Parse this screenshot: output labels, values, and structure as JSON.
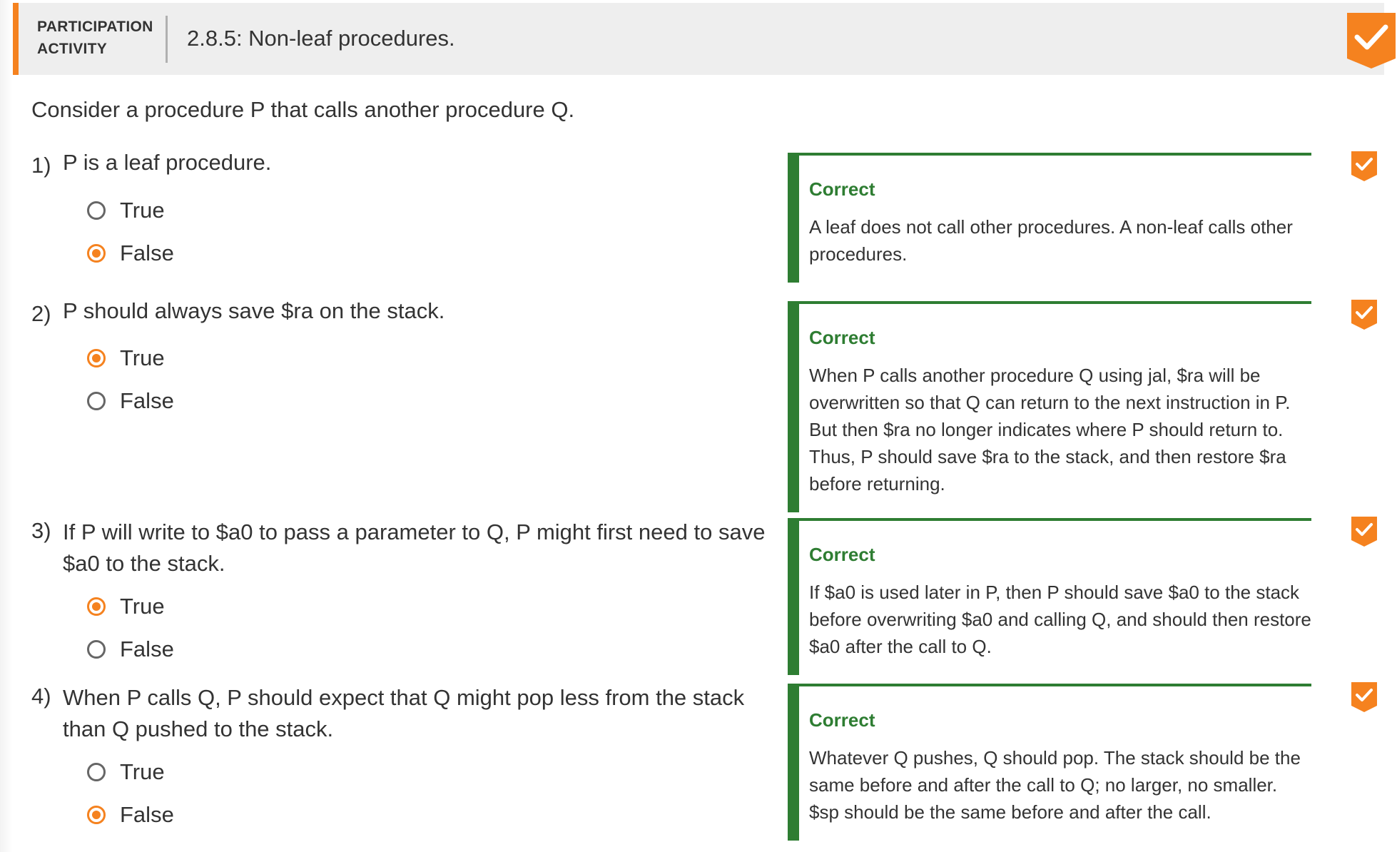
{
  "header": {
    "label_line1": "PARTICIPATION",
    "label_line2": "ACTIVITY",
    "title": "2.8.5: Non-leaf procedures."
  },
  "intro": "Consider a procedure P that calls another procedure Q.",
  "questions": [
    {
      "number": "1)",
      "text": "P is a leaf procedure.",
      "options": [
        {
          "label": "True",
          "selected": false
        },
        {
          "label": "False",
          "selected": true
        }
      ],
      "feedback": {
        "title": "Correct",
        "text": "A leaf does not call other procedures. A non-leaf calls other procedures."
      }
    },
    {
      "number": "2)",
      "text": "P should always save $ra on the stack.",
      "options": [
        {
          "label": "True",
          "selected": true
        },
        {
          "label": "False",
          "selected": false
        }
      ],
      "feedback": {
        "title": "Correct",
        "text": "When P calls another procedure Q using jal, $ra will be overwritten so that Q can return to the next instruction in P. But then $ra no longer indicates where P should return to. Thus, P should save $ra to the stack, and then restore $ra before returning."
      }
    },
    {
      "number": "3)",
      "text": "If P will write to $a0 to pass a parameter to Q, P might first need to save $a0 to the stack.",
      "options": [
        {
          "label": "True",
          "selected": true
        },
        {
          "label": "False",
          "selected": false
        }
      ],
      "feedback": {
        "title": "Correct",
        "text": "If $a0 is used later in P, then P should save $a0 to the stack before overwriting $a0 and calling Q, and should then restore $a0 after the call to Q."
      }
    },
    {
      "number": "4)",
      "text": "When P calls Q, P should expect that Q might pop less from the stack than Q pushed to the stack.",
      "options": [
        {
          "label": "True",
          "selected": false
        },
        {
          "label": "False",
          "selected": true
        }
      ],
      "feedback": {
        "title": "Correct",
        "text": "Whatever Q pushes, Q should pop. The stack should be the same before and after the call to Q; no larger, no smaller. $sp should be the same before and after the call."
      }
    }
  ],
  "colors": {
    "accent": "#f5821f",
    "correct": "#2e7d32"
  },
  "icons": {
    "completion": "checkmark-icon"
  }
}
